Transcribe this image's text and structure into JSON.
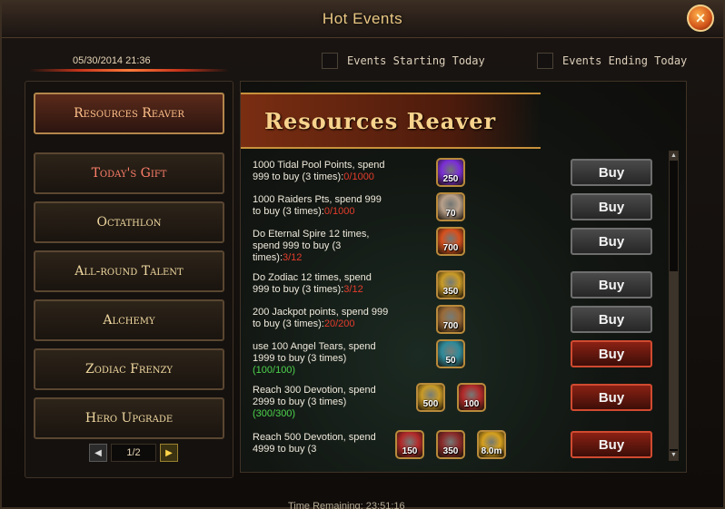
{
  "window": {
    "title": "Hot Events",
    "close_label": "×"
  },
  "header": {
    "datetime": "05/30/2014 21:36",
    "filters": [
      {
        "label": "Events Starting Today"
      },
      {
        "label": "Events Ending Today"
      }
    ]
  },
  "sidebar": {
    "items": [
      {
        "label": "Resources Reaver"
      },
      {
        "label": "Today's Gift"
      },
      {
        "label": "Octathlon"
      },
      {
        "label": "All-round Talent"
      },
      {
        "label": "Alchemy"
      },
      {
        "label": "Zodiac Frenzy"
      },
      {
        "label": "Hero Upgrade"
      }
    ],
    "pager": {
      "prev": "◀",
      "text": "1/2",
      "next": "▶"
    }
  },
  "main": {
    "banner": "Resources Reaver",
    "rows": [
      {
        "text": "1000 Tidal Pool Points, spend 999 to buy (3 times):",
        "progress": "0/1000",
        "status": "red",
        "rewards": [
          {
            "qty": "250",
            "color": "#7b2fd6"
          }
        ],
        "buy": "Buy",
        "buy_style": "gray"
      },
      {
        "text": "1000 Raiders Pts, spend 999 to buy (3 times):",
        "progress": "0/1000",
        "status": "red",
        "rewards": [
          {
            "qty": "70",
            "color": "#b8a08a"
          }
        ],
        "buy": "Buy",
        "buy_style": "gray"
      },
      {
        "text": "Do Eternal Spire 12 times, spend 999 to buy (3 times):",
        "progress": "3/12",
        "status": "red",
        "rewards": [
          {
            "qty": "700",
            "color": "#d6501e"
          }
        ],
        "buy": "Buy",
        "buy_style": "gray"
      },
      {
        "text": "Do Zodiac 12 times, spend 999 to buy (3 times):",
        "progress": "3/12",
        "status": "red",
        "rewards": [
          {
            "qty": "350",
            "color": "#c99a26"
          }
        ],
        "buy": "Buy",
        "buy_style": "gray"
      },
      {
        "text": "200 Jackpot points, spend 999 to buy (3 times):",
        "progress": "20/200",
        "status": "red",
        "rewards": [
          {
            "qty": "700",
            "color": "#9a6a38"
          }
        ],
        "buy": "Buy",
        "buy_style": "gray"
      },
      {
        "text": "use 100 Angel Tears, spend 1999 to buy (3 times)",
        "progress": "(100/100)",
        "status": "green",
        "rewards": [
          {
            "qty": "50",
            "color": "#2f8a9a"
          }
        ],
        "buy": "Buy",
        "buy_style": "red"
      },
      {
        "text": "Reach 300 Devotion, spend 2999 to buy (3 times)",
        "progress": "(300/300)",
        "status": "green",
        "rewards": [
          {
            "qty": "500",
            "color": "#c99a26"
          },
          {
            "qty": "100",
            "color": "#b32a2a"
          }
        ],
        "buy": "Buy",
        "buy_style": "red"
      },
      {
        "text": "Reach 500 Devotion, spend 4999 to buy (3",
        "progress": "",
        "status": "green",
        "rewards": [
          {
            "qty": "150",
            "color": "#b32a2a"
          },
          {
            "qty": "350",
            "color": "#8a2a2a"
          },
          {
            "qty": "8.0m",
            "color": "#d6a01e"
          }
        ],
        "buy": "Buy",
        "buy_style": "red"
      }
    ]
  },
  "footer": {
    "time_remaining": "Time Remaining: 23:51:16"
  }
}
